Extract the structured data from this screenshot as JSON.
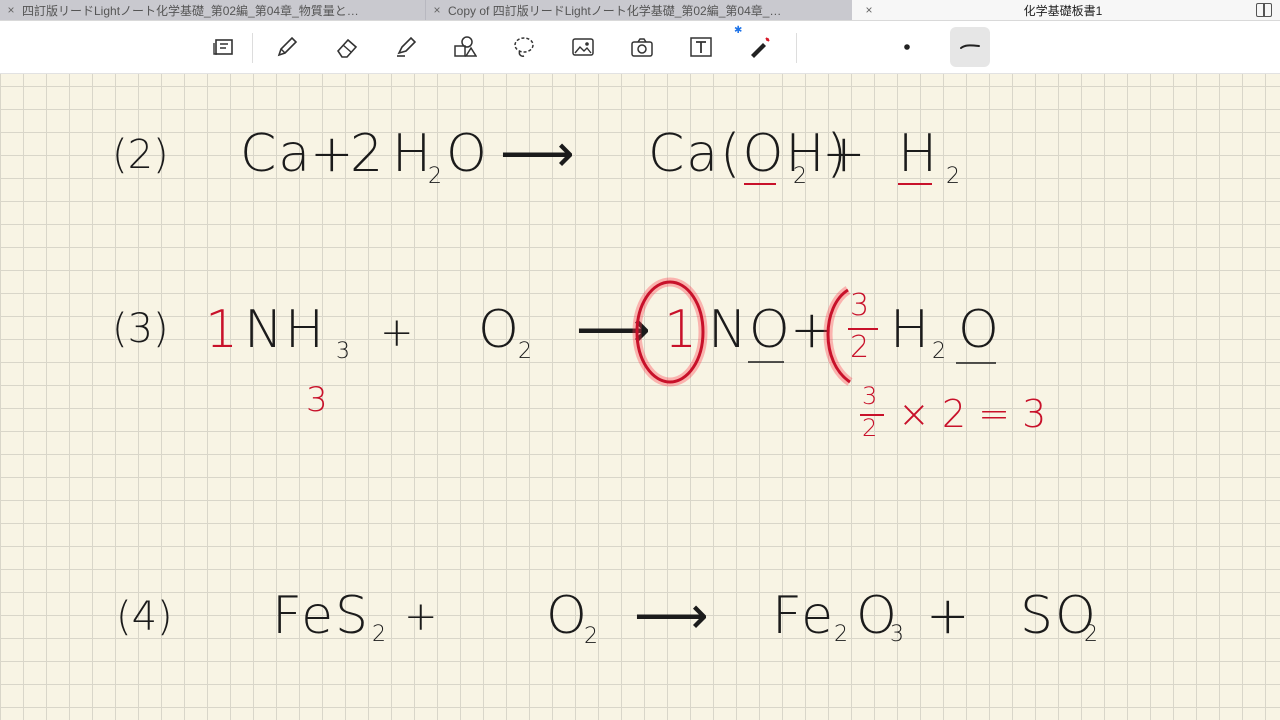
{
  "tabs": [
    {
      "close": "×",
      "title": "四訂版リードLightノート化学基礎_第02編_第04章_物質量と…"
    },
    {
      "close": "×",
      "title": "Copy of 四訂版リードLightノート化学基礎_第02編_第04章_…"
    },
    {
      "close": "×",
      "title": "化学基礎板書1"
    }
  ],
  "toolbar": {
    "tools": [
      "page-layout-icon",
      "pen-icon",
      "eraser-icon",
      "highlighter-icon",
      "shapes-icon",
      "lasso-icon",
      "image-icon",
      "camera-icon",
      "text-icon",
      "laser-pointer-icon"
    ],
    "bluetooth": "✱"
  },
  "equations": {
    "eq2": {
      "label": "(2)",
      "lhs1": "Ca",
      "plus1": "+",
      "coef": "2",
      "lhs2a": "H",
      "lhs2sub": "2",
      "lhs2b": "O",
      "arrow": "⟶",
      "rhs1": "Ca(OH)",
      "rhs1sub": "2",
      "plus2": "+",
      "rhs2": "H",
      "rhs2sub": "2"
    },
    "eq3": {
      "label": "(3)",
      "coef1": "1",
      "lhs1": "NH",
      "lhs1sub": "3",
      "plus1": "+",
      "lhs2": "O",
      "lhs2sub": "2",
      "arrow": "⟶",
      "coef3": "1",
      "rhs1": "NO",
      "plus2": "+",
      "coef4num": "3",
      "coef4den": "2",
      "rhs2": "H",
      "rhs2sub": "2",
      "rhs2b": "O",
      "under_nh3": "3",
      "calc_num": "3",
      "calc_den": "2",
      "calc_rest": "× 2 = 3"
    },
    "eq4": {
      "label": "(4)",
      "lhs1": "FeS",
      "lhs1sub": "2",
      "plus1": "+",
      "lhs2": "O",
      "lhs2sub": "2",
      "arrow": "⟶",
      "rhs1a": "Fe",
      "rhs1sub1": "2",
      "rhs1b": "O",
      "rhs1sub2": "3",
      "plus2": "+",
      "rhs2": "SO",
      "rhs2sub": "2"
    }
  }
}
